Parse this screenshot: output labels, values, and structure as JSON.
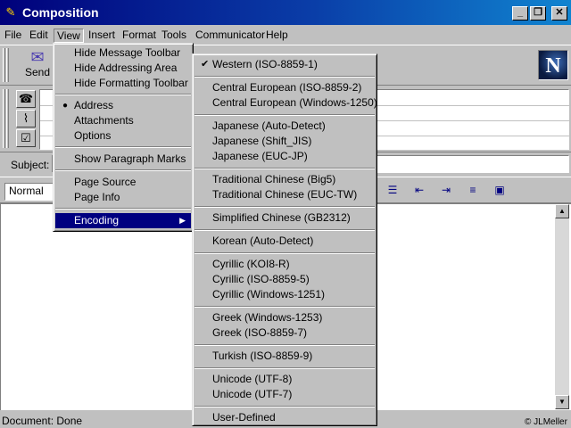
{
  "window": {
    "title": "Composition"
  },
  "menubar": [
    "File",
    "Edit",
    "View",
    "Insert",
    "Format",
    "Tools",
    "Communicator",
    "Help"
  ],
  "toolbar": {
    "send_label": "Send"
  },
  "logo": {
    "letter": "N"
  },
  "subject": {
    "label": "Subject:",
    "value": ""
  },
  "format_bar": {
    "style_value": "Normal"
  },
  "status": {
    "text": "Document: Done",
    "copyright": "© JLMeller"
  },
  "view_menu": {
    "items": [
      "Hide Message Toolbar",
      "Hide Addressing Area",
      "Hide Formatting Toolbar",
      "Address",
      "Attachments",
      "Options",
      "Show Paragraph Marks",
      "Page Source",
      "Page Info",
      "Encoding"
    ],
    "checked": "Address",
    "highlighted": "Encoding"
  },
  "encoding_menu": {
    "items": [
      "Western (ISO-8859-1)",
      "Central European (ISO-8859-2)",
      "Central European (Windows-1250)",
      "Japanese (Auto-Detect)",
      "Japanese (Shift_JIS)",
      "Japanese (EUC-JP)",
      "Traditional Chinese (Big5)",
      "Traditional Chinese (EUC-TW)",
      "Simplified Chinese (GB2312)",
      "Korean (Auto-Detect)",
      "Cyrillic (KOI8-R)",
      "Cyrillic (ISO-8859-5)",
      "Cyrillic (Windows-1251)",
      "Greek (Windows-1253)",
      "Greek (ISO-8859-7)",
      "Turkish (ISO-8859-9)",
      "Unicode (UTF-8)",
      "Unicode (UTF-7)",
      "User-Defined"
    ],
    "checked": "Western (ISO-8859-1)"
  },
  "colors": {
    "title_start": "#00007b",
    "title_end": "#1084d0",
    "menu_highlight": "#000080",
    "chrome": "#c0c0c0"
  }
}
